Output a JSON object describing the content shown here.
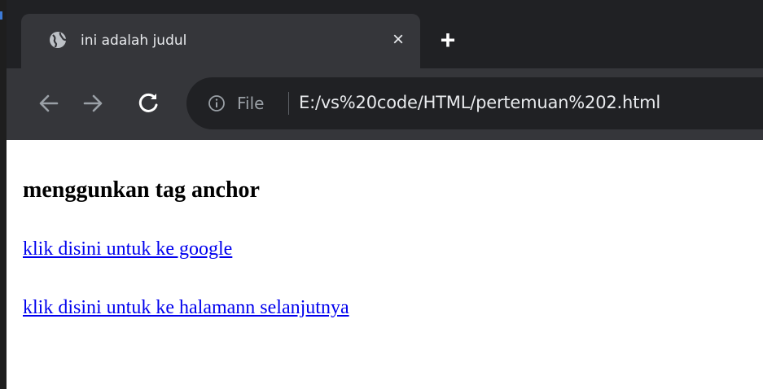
{
  "browser": {
    "tab": {
      "title": "ini adalah judul",
      "icon": "globe-icon",
      "close_label": "×"
    },
    "new_tab_label": "+",
    "toolbar": {
      "back_icon": "arrow-left-icon",
      "forward_icon": "arrow-right-icon",
      "reload_icon": "reload-icon",
      "info_icon": "info-icon",
      "scheme_label": "File",
      "url": "E:/vs%20code/HTML/pertemuan%202.html"
    },
    "colors": {
      "tabstrip": "#202124",
      "toolbar": "#35363a",
      "omnibox": "#202124",
      "link": "#0000ee"
    }
  },
  "page": {
    "heading": "menggunkan tag anchor",
    "links": [
      {
        "label": "klik disini untuk ke google"
      },
      {
        "label": "klik disini untuk ke halamann selanjutnya"
      }
    ]
  }
}
